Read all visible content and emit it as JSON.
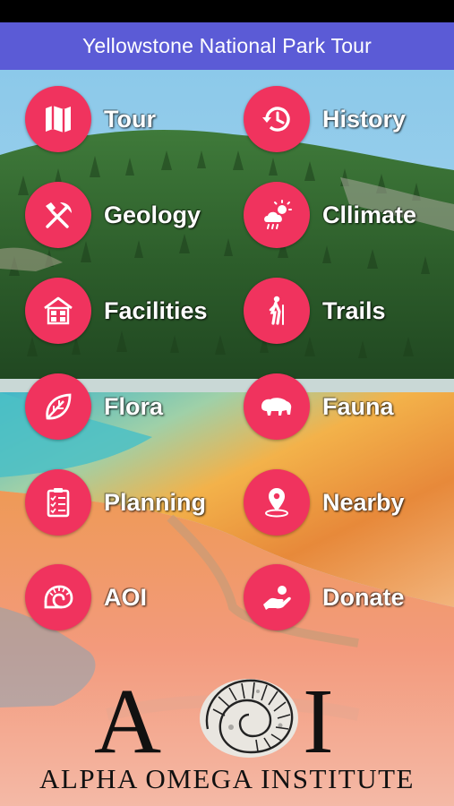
{
  "header": {
    "title": "Yellowstone National Park Tour"
  },
  "menu": {
    "tour": {
      "label": "Tour",
      "icon": "map-icon"
    },
    "history": {
      "label": "History",
      "icon": "history-icon"
    },
    "geology": {
      "label": "Geology",
      "icon": "pick-shovel-icon"
    },
    "climate": {
      "label": "Cllimate",
      "icon": "weather-icon"
    },
    "facilities": {
      "label": "Facilities",
      "icon": "building-icon"
    },
    "trails": {
      "label": "Trails",
      "icon": "hiker-icon"
    },
    "flora": {
      "label": "Flora",
      "icon": "leaf-icon"
    },
    "fauna": {
      "label": "Fauna",
      "icon": "bison-icon"
    },
    "planning": {
      "label": "Planning",
      "icon": "checklist-icon"
    },
    "nearby": {
      "label": "Nearby",
      "icon": "location-pin-icon"
    },
    "aoi": {
      "label": "AOI",
      "icon": "ammonite-icon"
    },
    "donate": {
      "label": "Donate",
      "icon": "hand-coin-icon"
    }
  },
  "logo": {
    "letter_a": "A",
    "letter_i": "I",
    "name": "ALPHA OMEGA INSTITUTE"
  },
  "colors": {
    "nav_bar": "#5b5bd6",
    "button_circle": "#f0335e",
    "label_text": "#ffffff"
  }
}
